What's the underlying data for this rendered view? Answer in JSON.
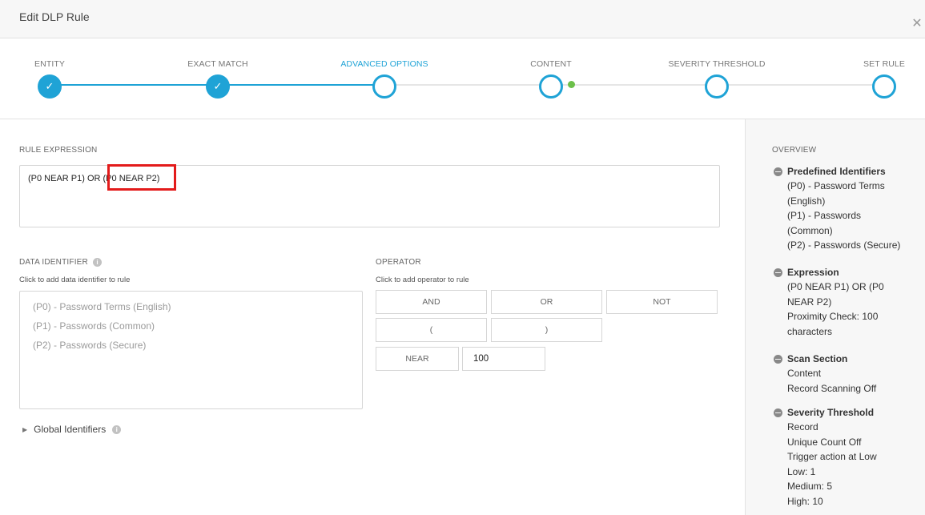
{
  "dialog": {
    "title": "Edit DLP Rule"
  },
  "steps": [
    {
      "label": "ENTITY",
      "state": "done"
    },
    {
      "label": "EXACT MATCH",
      "state": "done"
    },
    {
      "label": "ADVANCED OPTIONS",
      "state": "active"
    },
    {
      "label": "CONTENT",
      "state": "todo"
    },
    {
      "label": "SEVERITY THRESHOLD",
      "state": "todo"
    },
    {
      "label": "SET RULE",
      "state": "todo"
    }
  ],
  "rule_expression": {
    "label": "RULE EXPRESSION",
    "value": "(P0 NEAR P1) OR (P0 NEAR P2)"
  },
  "data_identifier": {
    "label": "DATA IDENTIFIER",
    "hint": "Click to add data identifier to rule",
    "items": [
      "(P0) - Password Terms (English)",
      "(P1) - Passwords (Common)",
      "(P2) - Passwords (Secure)"
    ]
  },
  "operator": {
    "label": "OPERATOR",
    "hint": "Click to add operator to rule",
    "buttons": {
      "and": "AND",
      "or": "OR",
      "not": "NOT",
      "open_paren": "(",
      "close_paren": ")",
      "near": "NEAR"
    },
    "proximity_value": "100"
  },
  "global_identifiers": {
    "label": "Global Identifiers"
  },
  "overview": {
    "label": "OVERVIEW",
    "groups": [
      {
        "title": "Predefined Identifiers",
        "lines": [
          "(P0) - Password Terms",
          "(English)",
          "(P1) - Passwords",
          "(Common)",
          "(P2) - Passwords (Secure)"
        ]
      },
      {
        "title": "Expression",
        "lines": [
          "(P0 NEAR P1) OR (P0",
          "NEAR P2)",
          "Proximity Check: 100",
          "characters"
        ]
      },
      {
        "title": "Scan Section",
        "lines": [
          "Content",
          "Record Scanning Off"
        ]
      },
      {
        "title": "Severity Threshold",
        "lines": [
          "Record",
          "Unique Count Off",
          "Trigger action at Low",
          "Low: 1",
          "Medium: 5",
          "High: 10"
        ]
      }
    ]
  },
  "colors": {
    "accent": "#1fa3d6",
    "highlight": "#e31b1b",
    "status_dot": "#6cc04a"
  },
  "icons": {
    "check": "check-icon",
    "close": "close-icon",
    "info": "info-icon",
    "collapse": "minus-circle-icon",
    "expand": "caret-right-icon"
  }
}
